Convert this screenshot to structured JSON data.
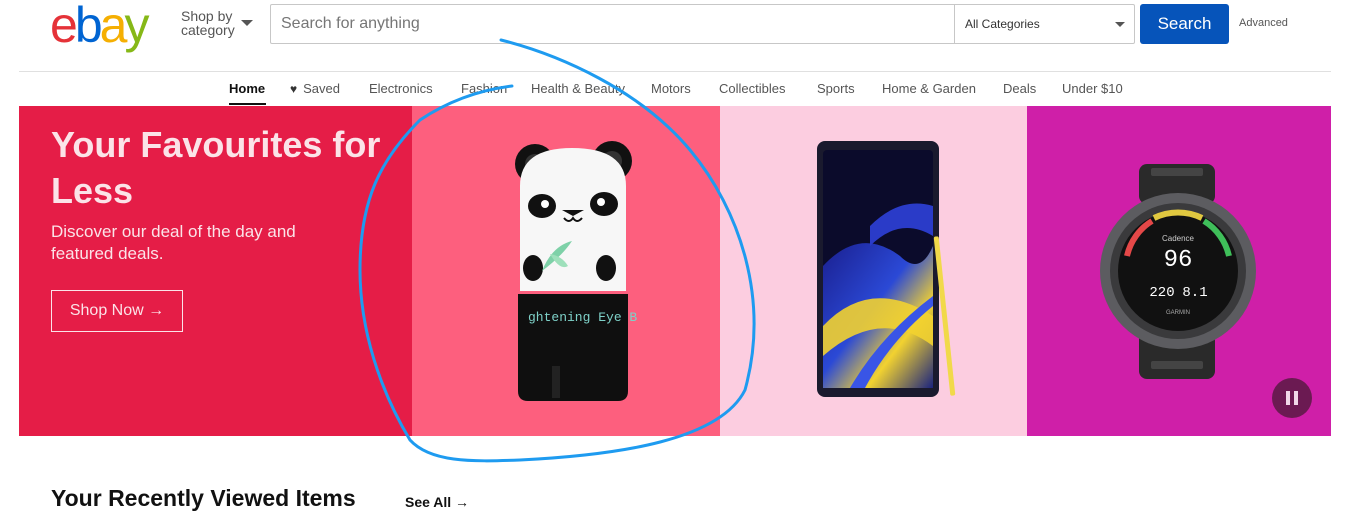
{
  "header": {
    "logo_text": "ebay",
    "shop_by_label": "Shop by category",
    "search_placeholder": "Search for anything",
    "category_select": "All Categories",
    "search_button": "Search",
    "advanced_link": "Advanced"
  },
  "nav": {
    "items": [
      {
        "label": "Home",
        "active": true
      },
      {
        "label": "Saved",
        "icon": "heart-icon"
      },
      {
        "label": "Electronics"
      },
      {
        "label": "Fashion"
      },
      {
        "label": "Health & Beauty"
      },
      {
        "label": "Motors"
      },
      {
        "label": "Collectibles"
      },
      {
        "label": "Sports"
      },
      {
        "label": "Home & Garden"
      },
      {
        "label": "Deals"
      },
      {
        "label": "Under $10"
      }
    ]
  },
  "hero": {
    "title": "Your Favourites for Less",
    "subtitle": "Discover our deal of the day and featured deals.",
    "cta_label": "Shop Now →",
    "product_label_text": "ghtening Eye B",
    "watch_screen": {
      "line1": "Cadence",
      "line2": "96",
      "line3a": "220",
      "line3b": "8.1",
      "brand": "GARMIN"
    },
    "colors": {
      "text_panel": "#e51d47",
      "panel_a": "#fd5f7e",
      "panel_b": "#fccde0",
      "panel_c": "#cf1fa8"
    }
  },
  "recent": {
    "title": "Your Recently Viewed Items",
    "see_all": "See All →"
  },
  "colors": {
    "search_button": "#0654ba",
    "annotation_stroke": "#1e9bf0"
  }
}
